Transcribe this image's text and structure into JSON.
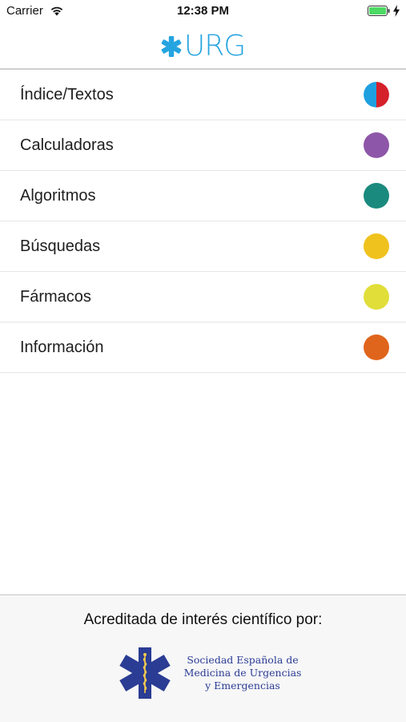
{
  "status_bar": {
    "carrier": "Carrier",
    "time": "12:38 PM",
    "battery_color": "#4cd964"
  },
  "header": {
    "logo_text": "URG",
    "brand_color": "#25a4e0"
  },
  "menu": {
    "items": [
      {
        "label": "Índice/Textos",
        "color_left": "#1e9fe0",
        "color_right": "#d4212b"
      },
      {
        "label": "Calculadoras",
        "color": "#8e56a8"
      },
      {
        "label": "Algoritmos",
        "color": "#1b8a7e"
      },
      {
        "label": "Búsquedas",
        "color": "#f0c21e"
      },
      {
        "label": "Fármacos",
        "color": "#e1de3a"
      },
      {
        "label": "Información",
        "color": "#e0651c"
      }
    ]
  },
  "footer": {
    "accreditation_text": "Acreditada de interés científico por:",
    "organization_lines": [
      "Sociedad Española de",
      "Medicina de Urgencias",
      "y Emergencias"
    ],
    "logo_color": "#2b3c94"
  }
}
